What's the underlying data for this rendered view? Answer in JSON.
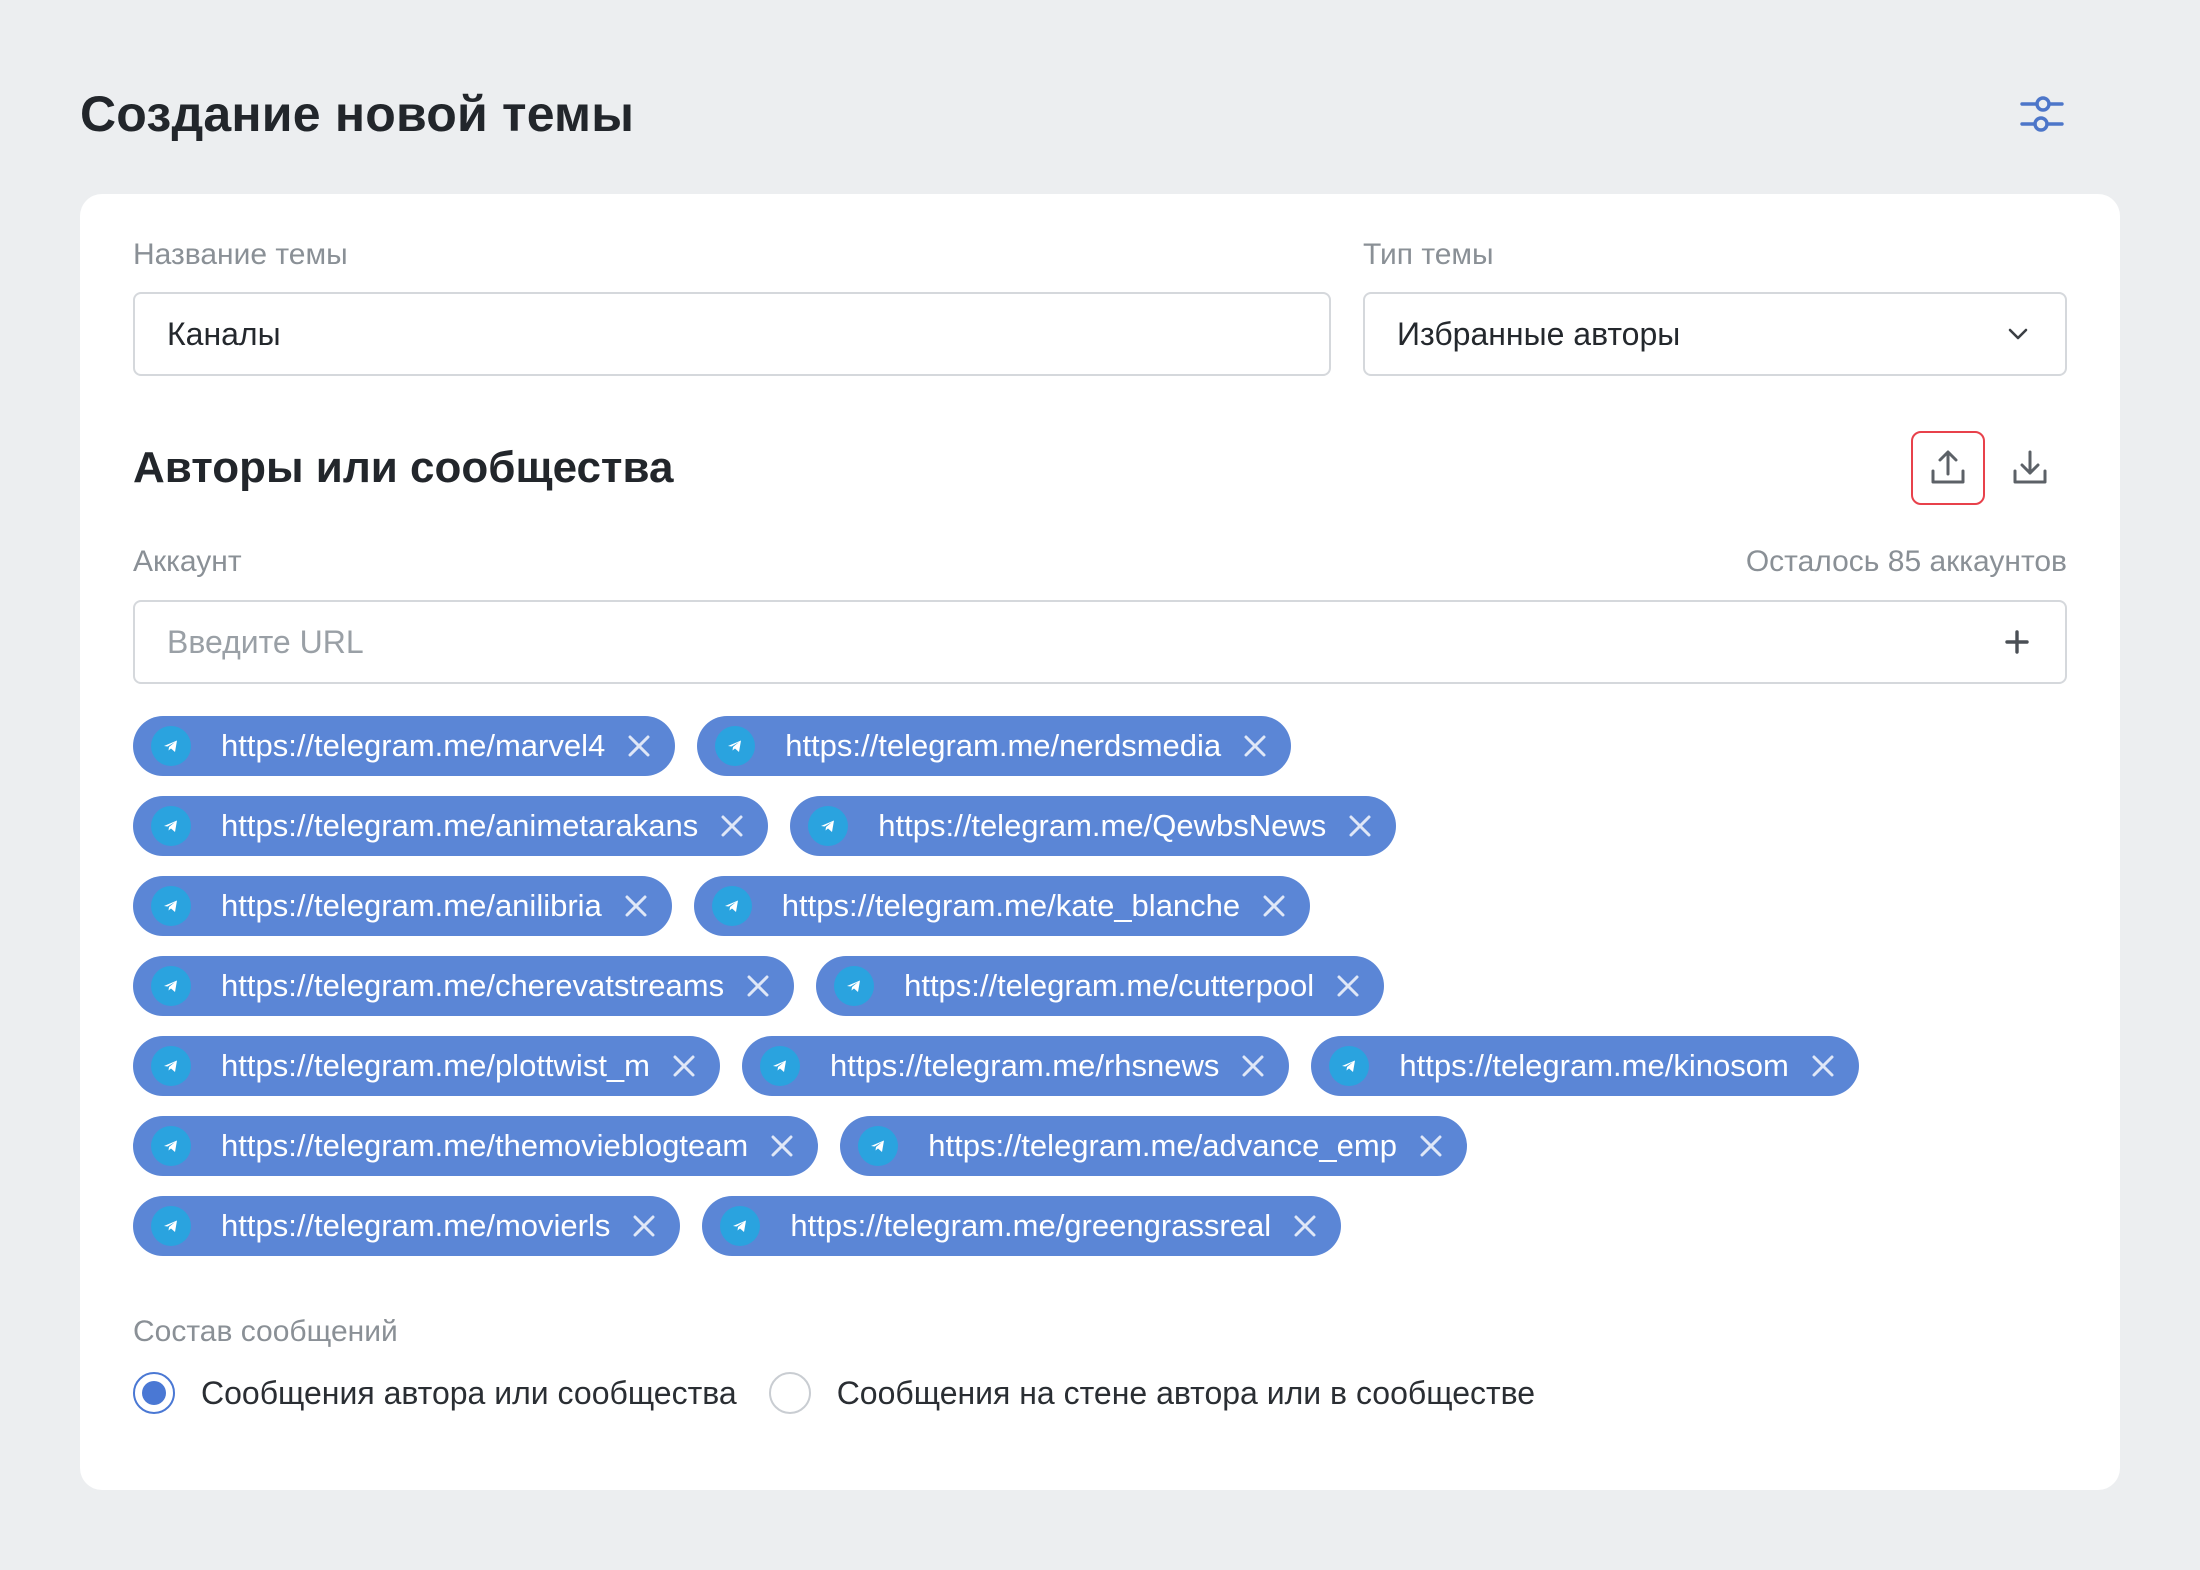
{
  "header": {
    "title": "Создание новой темы",
    "settings_icon": "sliders-icon"
  },
  "form": {
    "name_label": "Название темы",
    "name_value": "Каналы",
    "type_label": "Тип темы",
    "type_value": "Избранные авторы"
  },
  "authors": {
    "section_title": "Авторы или сообщества",
    "upload_icon": "upload-icon",
    "download_icon": "download-icon",
    "account_label": "Аккаунт",
    "remaining_text": "Осталось 85 аккаунтов",
    "url_placeholder": "Введите URL",
    "tag_rows": [
      [
        "https://telegram.me/marvel4",
        "https://telegram.me/nerdsmedia"
      ],
      [
        "https://telegram.me/animetarakans",
        "https://telegram.me/QewbsNews"
      ],
      [
        "https://telegram.me/anilibria",
        "https://telegram.me/kate_blanche"
      ],
      [
        "https://telegram.me/cherevatstreams",
        "https://telegram.me/cutterpool"
      ],
      [
        "https://telegram.me/plottwist_m",
        "https://telegram.me/rhsnews",
        "https://telegram.me/kinosom"
      ],
      [
        "https://telegram.me/themovieblogteam",
        "https://telegram.me/advance_emp"
      ],
      [
        "https://telegram.me/movierls",
        "https://telegram.me/greengrassreal"
      ]
    ]
  },
  "composition": {
    "label": "Состав сообщений",
    "option_author": "Сообщения автора или сообщества",
    "option_wall": "Сообщения на стене автора или в сообществе",
    "selected": "option_author"
  },
  "colors": {
    "tag_bg": "#5b86d6",
    "telegram": "#2aa3df",
    "active_border": "#e8414b",
    "radio_accent": "#4a78d4"
  }
}
